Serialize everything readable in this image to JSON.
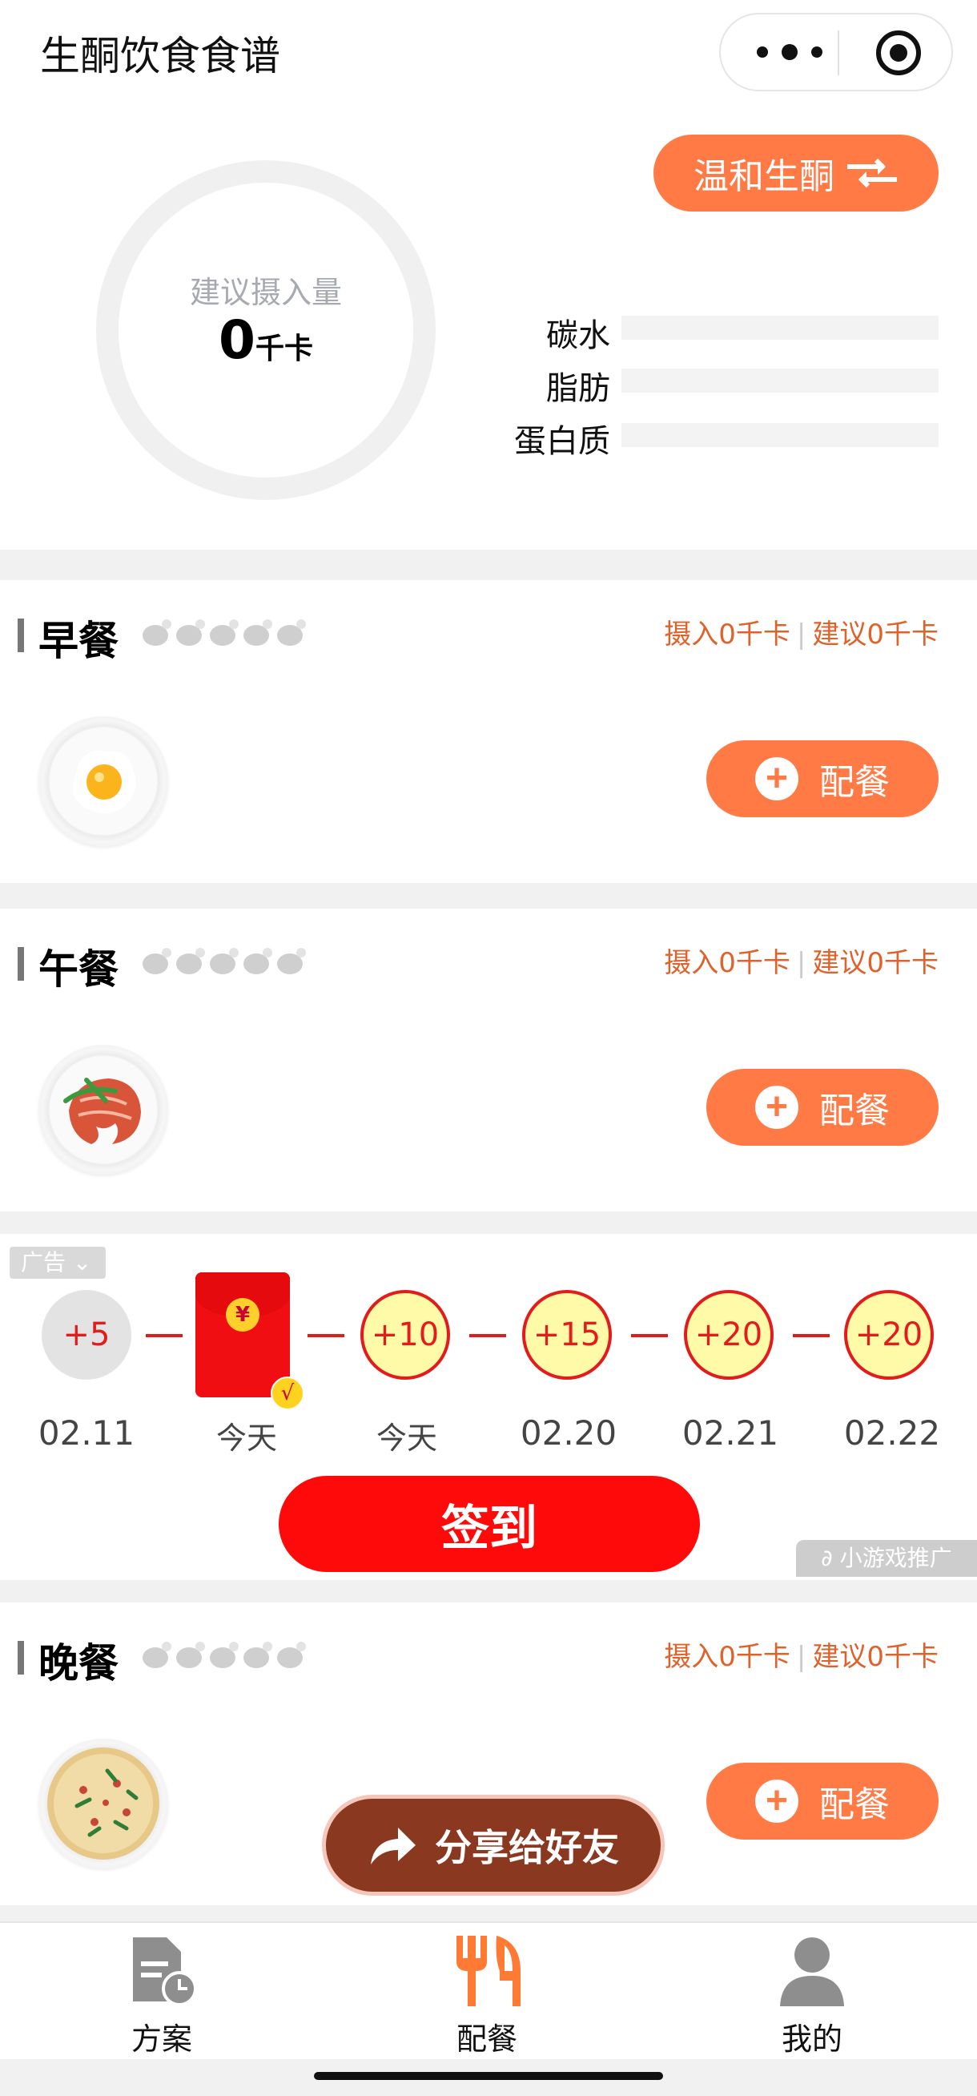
{
  "header": {
    "title": "生酮饮食食谱"
  },
  "summary": {
    "ring_label": "建议摄入量",
    "calories_value": "0",
    "calories_unit": "千卡",
    "mode_button": "温和生酮",
    "macros": [
      "碳水",
      "脂肪",
      "蛋白质"
    ]
  },
  "meals": [
    {
      "name": "早餐",
      "intake": "摄入0千卡",
      "suggest": "建议0千卡",
      "add_label": "配餐",
      "dish_icon": "fried-egg-icon"
    },
    {
      "name": "午餐",
      "intake": "摄入0千卡",
      "suggest": "建议0千卡",
      "add_label": "配餐",
      "dish_icon": "salmon-dish-icon"
    },
    {
      "name": "晚餐",
      "intake": "摄入0千卡",
      "suggest": "建议0千卡",
      "add_label": "配餐",
      "dish_icon": "pizza-dish-icon"
    }
  ],
  "ad": {
    "tag": "广告",
    "days": [
      {
        "bonus": "+5",
        "date": "02.11"
      },
      {
        "bonus": "¥",
        "date": "今天"
      },
      {
        "bonus": "+10",
        "date": "今天"
      },
      {
        "bonus": "+15",
        "date": "02.20"
      },
      {
        "bonus": "+20",
        "date": "02.21"
      },
      {
        "bonus": "+20",
        "date": "02.22"
      }
    ],
    "checkin_button": "签到",
    "promo": "小游戏推广"
  },
  "share_button": "分享给好友",
  "tabs": [
    {
      "label": "方案",
      "icon": "plan-icon",
      "active": false
    },
    {
      "label": "配餐",
      "icon": "fork-knife-icon",
      "active": true
    },
    {
      "label": "我的",
      "icon": "user-icon",
      "active": false
    }
  ],
  "colors": {
    "accent": "#ff7a45",
    "info_text": "#e0622b",
    "checkin_red": "#ff0a0a",
    "share_brown": "#8b3820"
  }
}
